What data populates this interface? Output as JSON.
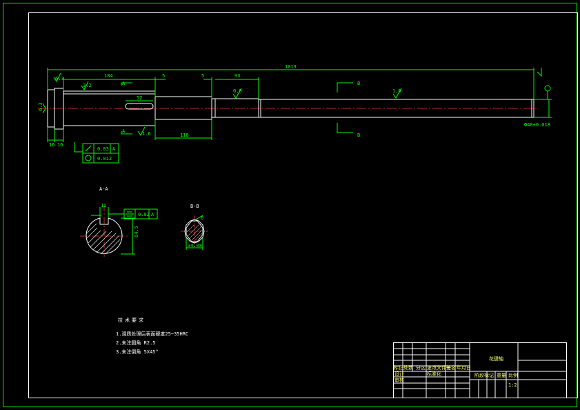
{
  "dimensions": {
    "overall_length": "1013",
    "seg_184": "184",
    "gap_5a": "5",
    "gap_5b": "5",
    "seg_93": "93",
    "seg_118": "118",
    "keyway_52": "52",
    "left_16a": "16",
    "left_16b": "16",
    "dia_left": "6.3",
    "end_fit": "Ф40±0.018",
    "key_width": "12",
    "key_depth": "64.5",
    "bb_width": "6",
    "bb_height": "34.08"
  },
  "roughness": {
    "r1": "3.2",
    "r2": "1.6",
    "r3": "0.8",
    "r4": "1.6",
    "r5": "6.3"
  },
  "section_marks": {
    "a_top": "A",
    "a_bottom": "A",
    "b_top": "B",
    "b_bottom": "B",
    "aa_title": "A-A",
    "bb_title": "B-B"
  },
  "tolerances": {
    "runout_value": "0.03",
    "runout_datum": "A",
    "cyl_value": "0.012",
    "sym_value": "0.02",
    "sym_datum": "A"
  },
  "tech_notes": {
    "title": "技术要求",
    "line1": "1.调质处理后表面硬度25~35HRC",
    "line2": "2.未注圆角 R2.5",
    "line3": "3.未注倒角 5X45°"
  },
  "title_block": {
    "part_name": "花键轴",
    "row_labels": [
      "标记",
      "处数",
      "分区",
      "更改文件号",
      "签名",
      "年月日"
    ],
    "designer": "设计",
    "standardization": "标准化",
    "reviewer": "审核",
    "stage_label": "阶段标记",
    "weight_label": "重量",
    "scale_label": "比例",
    "scale_value": "1:2"
  }
}
